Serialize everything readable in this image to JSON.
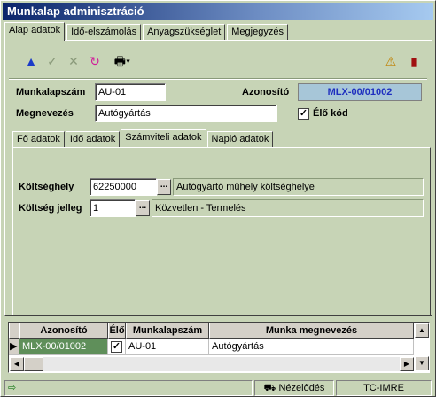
{
  "window": {
    "title": "Munkalap adminisztráció"
  },
  "tabs": [
    "Alap adatok",
    "Idő-elszámolás",
    "Anyagszükséglet",
    "Megjegyzés"
  ],
  "form": {
    "munkalapszam_label": "Munkalapszám",
    "munkalapszam_value": "AU-01",
    "azonosito_label": "Azonosító",
    "azonosito_value": "MLX-00/01002",
    "megnevezes_label": "Megnevezés",
    "megnevezes_value": "Autógyártás",
    "elo_kod_label": "Élő kód",
    "elo_kod_checked": "✓"
  },
  "subtabs": [
    "Fő adatok",
    "Idő adatok",
    "Számviteli adatok",
    "Napló adatok"
  ],
  "accounting": {
    "koltseghely_label": "Költséghely",
    "koltseghely_value": "62250000",
    "koltseghely_desc": "Autógyártó műhely költséghelye",
    "koltseg_jelleg_label": "Költség jelleg",
    "koltseg_jelleg_value": "1",
    "koltseg_jelleg_desc": "Közvetlen - Termelés",
    "ellipsis": "..."
  },
  "grid": {
    "headers": [
      "Azonosító",
      "Élő",
      "Munkalapszám",
      "Munka megnevezés"
    ],
    "rows": [
      {
        "azonosito": "MLX-00/01002",
        "elo": "✓",
        "munkalapszam": "AU-01",
        "megnevezes": "Autógyártás"
      }
    ]
  },
  "status": {
    "mode": "Nézelődés",
    "user": "TC-IMRE"
  },
  "colors": {
    "accent": "#1f2fbf",
    "panel": "#c7d4b6",
    "id_bg": "#a7c6d8",
    "row_selected": "#5f8f5a"
  }
}
